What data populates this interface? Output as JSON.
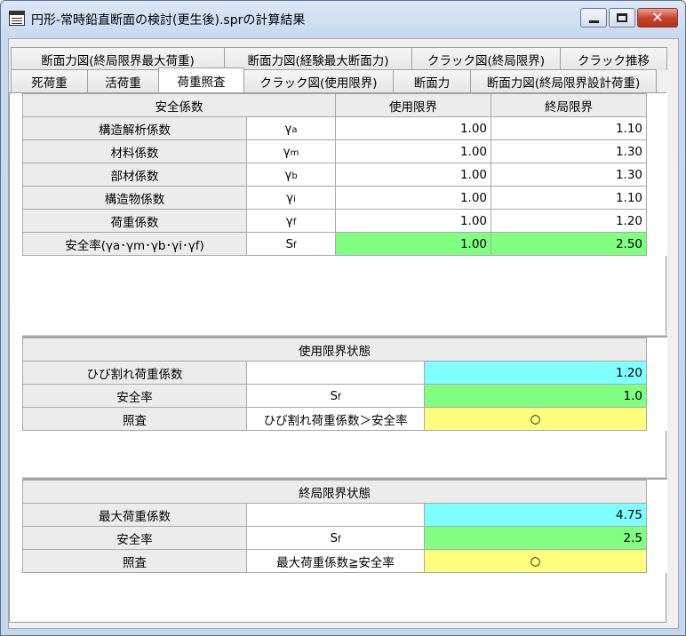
{
  "window": {
    "title": "円形-常時鉛直断面の検討(更生後).sprの計算結果",
    "close_glyph": "✕"
  },
  "tabs": {
    "back": [
      {
        "label": "断面力図(終局限界最大荷重)"
      },
      {
        "label": "断面力図(経験最大断面力)"
      },
      {
        "label": "クラック図(終局限界)"
      },
      {
        "label": "クラック推移"
      }
    ],
    "front": [
      {
        "label": "死荷重"
      },
      {
        "label": "活荷重"
      },
      {
        "label": "荷重照査"
      },
      {
        "label": "クラック図(使用限界)"
      },
      {
        "label": "断面力"
      },
      {
        "label": "断面力図(終局限界設計荷重)"
      }
    ],
    "active": "荷重照査"
  },
  "safety_factors": {
    "header": "安全係数",
    "col_service": "使用限界",
    "col_ultimate": "終局限界",
    "rows": [
      {
        "label": "構造解析係数",
        "symbol": "γ",
        "sub": "a",
        "service": "1.00",
        "ultimate": "1.10"
      },
      {
        "label": "材料係数",
        "symbol": "γ",
        "sub": "m",
        "service": "1.00",
        "ultimate": "1.30"
      },
      {
        "label": "部材係数",
        "symbol": "γ",
        "sub": "b",
        "service": "1.00",
        "ultimate": "1.30"
      },
      {
        "label": "構造物係数",
        "symbol": "γ",
        "sub": "i",
        "service": "1.00",
        "ultimate": "1.10"
      },
      {
        "label": "荷重係数",
        "symbol": "γ",
        "sub": "f",
        "service": "1.00",
        "ultimate": "1.20"
      }
    ],
    "total": {
      "label": "安全率(γa･γm･γb･γi･γf)",
      "symbol": "S",
      "sub": "f",
      "service": "1.00",
      "ultimate": "2.50"
    }
  },
  "service_state": {
    "header": "使用限界状態",
    "rows": [
      {
        "label": "ひび割れ荷重係数",
        "mid": "",
        "value": "1.20"
      },
      {
        "label": "安全率",
        "mid": "S",
        "mid_sub": "f",
        "value": "1.0"
      },
      {
        "label": "照査",
        "mid": "ひび割れ荷重係数＞安全率",
        "value": "○"
      }
    ]
  },
  "ultimate_state": {
    "header": "終局限界状態",
    "rows": [
      {
        "label": "最大荷重係数",
        "mid": "",
        "value": "4.75"
      },
      {
        "label": "安全率",
        "mid": "S",
        "mid_sub": "f",
        "value": "2.5"
      },
      {
        "label": "照査",
        "mid": "最大荷重係数≧安全率",
        "value": "○"
      }
    ]
  },
  "colors": {
    "highlight_green": "#80ff80",
    "highlight_cyan": "#80ffff",
    "highlight_yellow": "#ffff80"
  }
}
